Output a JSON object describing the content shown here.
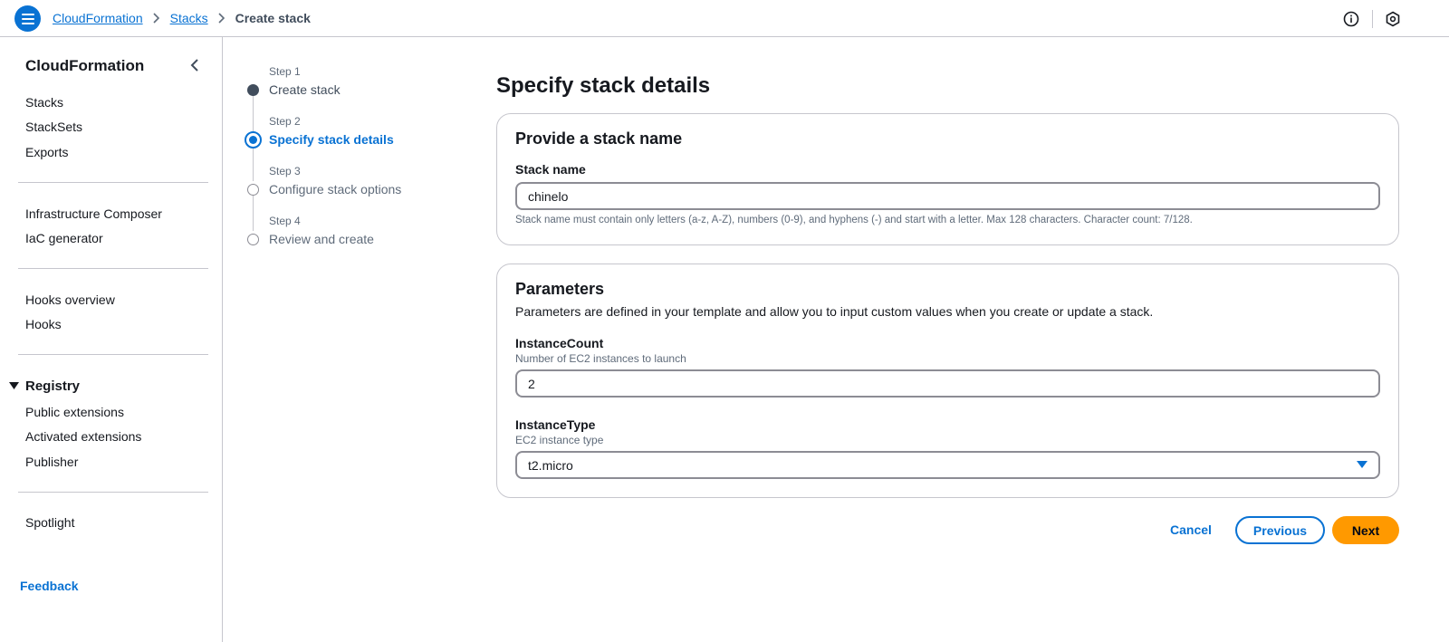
{
  "header": {
    "breadcrumbs": [
      "CloudFormation",
      "Stacks",
      "Create stack"
    ]
  },
  "sidebar": {
    "title": "CloudFormation",
    "group1": [
      "Stacks",
      "StackSets",
      "Exports"
    ],
    "group2": [
      "Infrastructure Composer",
      "IaC generator"
    ],
    "group3": [
      "Hooks overview",
      "Hooks"
    ],
    "registry": {
      "label": "Registry",
      "items": [
        "Public extensions",
        "Activated extensions",
        "Publisher"
      ]
    },
    "group5": [
      "Spotlight"
    ],
    "feedback": "Feedback"
  },
  "steps": [
    {
      "num": "Step 1",
      "label": "Create stack",
      "state": "completed"
    },
    {
      "num": "Step 2",
      "label": "Specify stack details",
      "state": "active"
    },
    {
      "num": "Step 3",
      "label": "Configure stack options",
      "state": "upcoming"
    },
    {
      "num": "Step 4",
      "label": "Review and create",
      "state": "upcoming"
    }
  ],
  "main": {
    "title": "Specify stack details",
    "stack_name_section": {
      "heading": "Provide a stack name",
      "label": "Stack name",
      "value": "chinelo",
      "constraint": "Stack name must contain only letters (a-z, A-Z), numbers (0-9), and hyphens (-) and start with a letter. Max 128 characters. Character count: 7/128."
    },
    "parameters_section": {
      "heading": "Parameters",
      "description": "Parameters are defined in your template and allow you to input custom values when you create or update a stack.",
      "instance_count": {
        "label": "InstanceCount",
        "description": "Number of EC2 instances to launch",
        "value": "2"
      },
      "instance_type": {
        "label": "InstanceType",
        "description": "EC2 instance type",
        "value": "t2.micro"
      }
    }
  },
  "actions": {
    "cancel": "Cancel",
    "previous": "Previous",
    "next": "Next"
  },
  "colors": {
    "accent": "#0972d3",
    "primary_button": "#ff9900"
  }
}
